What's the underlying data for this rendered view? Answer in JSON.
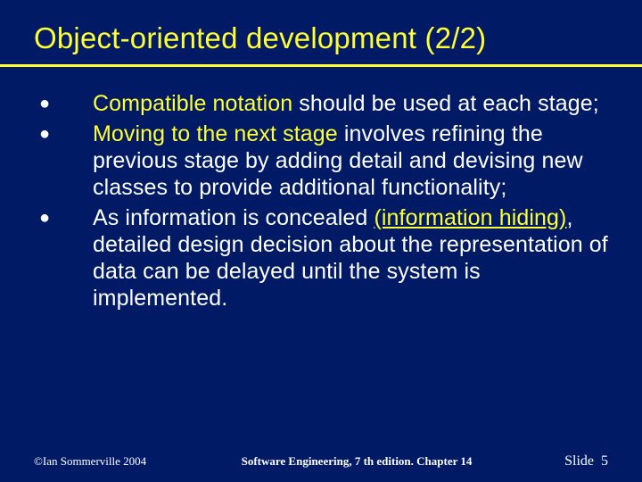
{
  "title": "Object-oriented development (2/2)",
  "bullets": [
    {
      "hl": "Compatible notation",
      "rest": " should be used at each stage;"
    },
    {
      "hl": "Moving to the next stage",
      "rest": " involves refining the previous stage by adding detail and devising new classes to provide additional functionality;"
    },
    {
      "pre": "As information is concealed ",
      "hl_underlined": "(information hiding)",
      "rest": ", detailed design decision about the representation of data can be delayed until the system is implemented."
    }
  ],
  "footer": {
    "left": "©Ian Sommerville 2004",
    "center": "Software Engineering, 7 th edition. Chapter 14",
    "right_label": "Slide",
    "right_num": "5"
  }
}
